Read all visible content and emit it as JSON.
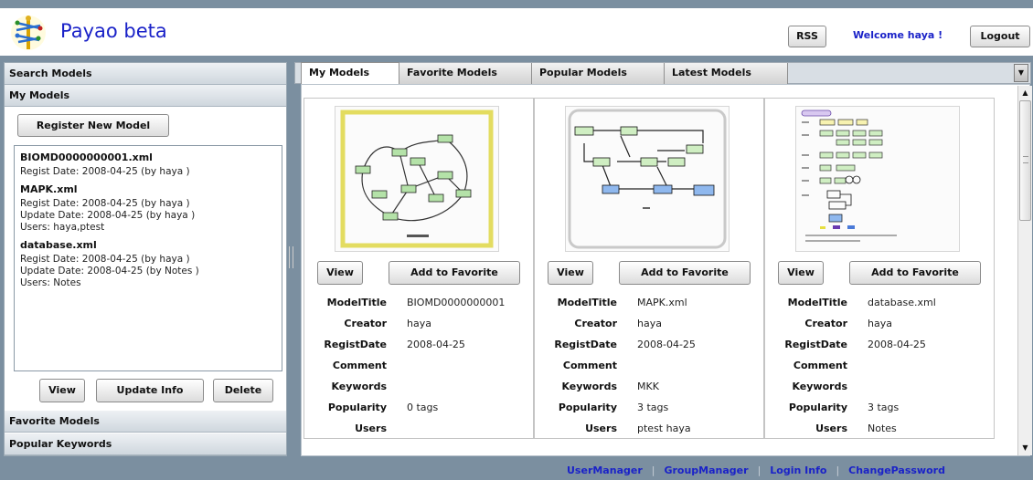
{
  "header": {
    "title": "Payao beta",
    "rss_label": "RSS",
    "welcome": "Welcome haya !",
    "logout_label": "Logout"
  },
  "left": {
    "sections": [
      "Search Models",
      "My Models",
      "Favorite Models",
      "Popular Keywords"
    ],
    "register_label": "Register New Model",
    "models": [
      {
        "name": "BIOMD0000000001.xml",
        "lines": [
          "Regist Date: 2008-04-25 (by haya )"
        ]
      },
      {
        "name": "MAPK.xml",
        "lines": [
          "Regist Date: 2008-04-25 (by haya )",
          "Update Date: 2008-04-25 (by haya )",
          "Users: haya,ptest"
        ]
      },
      {
        "name": "database.xml",
        "lines": [
          "Regist Date: 2008-04-25 (by haya )",
          "Update Date: 2008-04-25 (by Notes )",
          "Users: Notes"
        ]
      }
    ],
    "view_label": "View",
    "update_label": "Update Info",
    "delete_label": "Delete"
  },
  "tabs": [
    "My Models",
    "Favorite Models",
    "Popular Models",
    "Latest Models"
  ],
  "card_labels": [
    "ModelTitle",
    "Creator",
    "RegistDate",
    "Comment",
    "Keywords",
    "Popularity",
    "Users"
  ],
  "card_buttons": {
    "view": "View",
    "favorite": "Add to Favorite"
  },
  "cards": [
    {
      "ModelTitle": "BIOMD0000000001",
      "Creator": "haya",
      "RegistDate": "2008-04-25",
      "Comment": "",
      "Keywords": "",
      "Popularity": "0 tags",
      "Users": ""
    },
    {
      "ModelTitle": "MAPK.xml",
      "Creator": "haya",
      "RegistDate": "2008-04-25",
      "Comment": "",
      "Keywords": "MKK",
      "Popularity": "3 tags",
      "Users": "ptest haya"
    },
    {
      "ModelTitle": "database.xml",
      "Creator": "haya",
      "RegistDate": "2008-04-25",
      "Comment": "",
      "Keywords": "",
      "Popularity": "3 tags",
      "Users": "Notes"
    }
  ],
  "footer": [
    "UserManager",
    "GroupManager",
    "Login Info",
    "ChangePassword"
  ],
  "colors": {
    "link": "#1a22c8",
    "background": "#7b8fa0",
    "highlight": "#e8e06a"
  }
}
